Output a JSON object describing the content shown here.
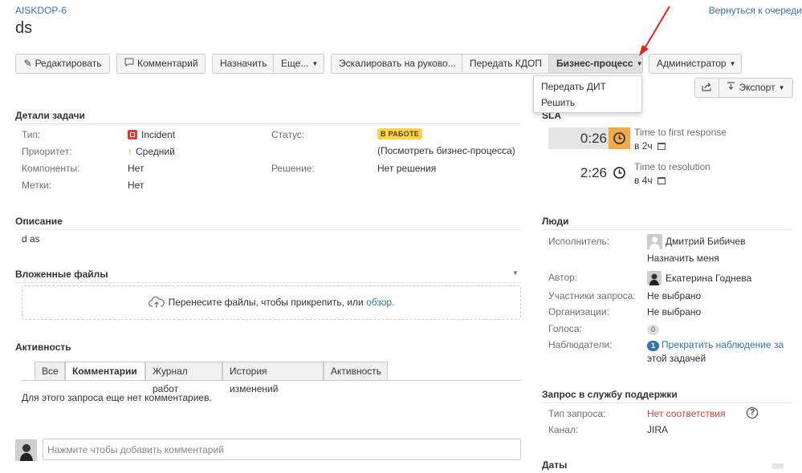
{
  "header": {
    "issue_key": "AISKDOP-6",
    "title": "ds",
    "return_link": "Вернуться к очереди"
  },
  "toolbar": {
    "edit": "Редактировать",
    "comment": "Комментарий",
    "assign": "Назначить",
    "more": "Еще...",
    "escalate": "Эскалировать на руково...",
    "transfer_kdop": "Передать КДОП",
    "business_process": "Бизнес-процесс",
    "admin": "Администратор",
    "export": "Экспорт"
  },
  "bp_menu": {
    "items": [
      "Передать ДИТ",
      "Решить"
    ]
  },
  "details": {
    "heading": "Детали задачи",
    "type_label": "Тип:",
    "type_value": "Incident",
    "priority_label": "Приоритет:",
    "priority_value": "Средний",
    "components_label": "Компоненты:",
    "components_value": "Нет",
    "labels_label": "Метки:",
    "labels_value": "Нет",
    "status_label": "Статус:",
    "status_value": "В РАБОТЕ",
    "view_bp_link": "(Посмотреть бизнес-процесса)",
    "resolution_label": "Решение:",
    "resolution_value": "Нет решения"
  },
  "description": {
    "heading": "Описание",
    "text": "d as"
  },
  "attachments": {
    "heading": "Вложенные файлы",
    "drop_text": "Перенесите файлы, чтобы прикрепить, или",
    "browse_link": "обзор."
  },
  "activity": {
    "heading": "Активность",
    "tabs": [
      "Все",
      "Комментарии",
      "Журнал работ",
      "История изменений",
      "Активность"
    ],
    "empty_text": "Для этого запроса еще нет комментариев.",
    "comment_placeholder": "Нажмите чтобы добавить комментарий"
  },
  "sla": {
    "heading": "SLA",
    "items": [
      {
        "time": "0:26",
        "name": "Time to first response",
        "goal": "в 2ч"
      },
      {
        "time": "2:26",
        "name": "Time to resolution",
        "goal": "в 4ч"
      }
    ]
  },
  "people": {
    "heading": "Люди",
    "assignee_label": "Исполнитель:",
    "assignee_value": "Дмитрий Бибичев",
    "assign_me": "Назначить меня",
    "author_label": "Автор:",
    "author_value": "Екатерина Годнева",
    "participants_label": "Участники запроса:",
    "participants_value": "Не выбрано",
    "orgs_label": "Организации:",
    "orgs_value": "Не выбрано",
    "votes_label": "Голоса:",
    "votes_value": "0",
    "watchers_label": "Наблюдатели:",
    "watchers_count": "1",
    "watchers_link_1": "Прекратить наблюдение за",
    "watchers_link_2": "этой задачей"
  },
  "service_request": {
    "heading": "Запрос в службу поддержки",
    "type_label": "Тип запроса:",
    "type_value": "Нет соответствия",
    "channel_label": "Канал:",
    "channel_value": "JIRA"
  },
  "dates": {
    "heading": "Даты"
  },
  "colors": {
    "link": "#3572b0",
    "status_yellow": "#ffd351",
    "sla_orange": "#f0ab48",
    "error_red": "#d04437",
    "arrow_red": "#e8221b"
  }
}
